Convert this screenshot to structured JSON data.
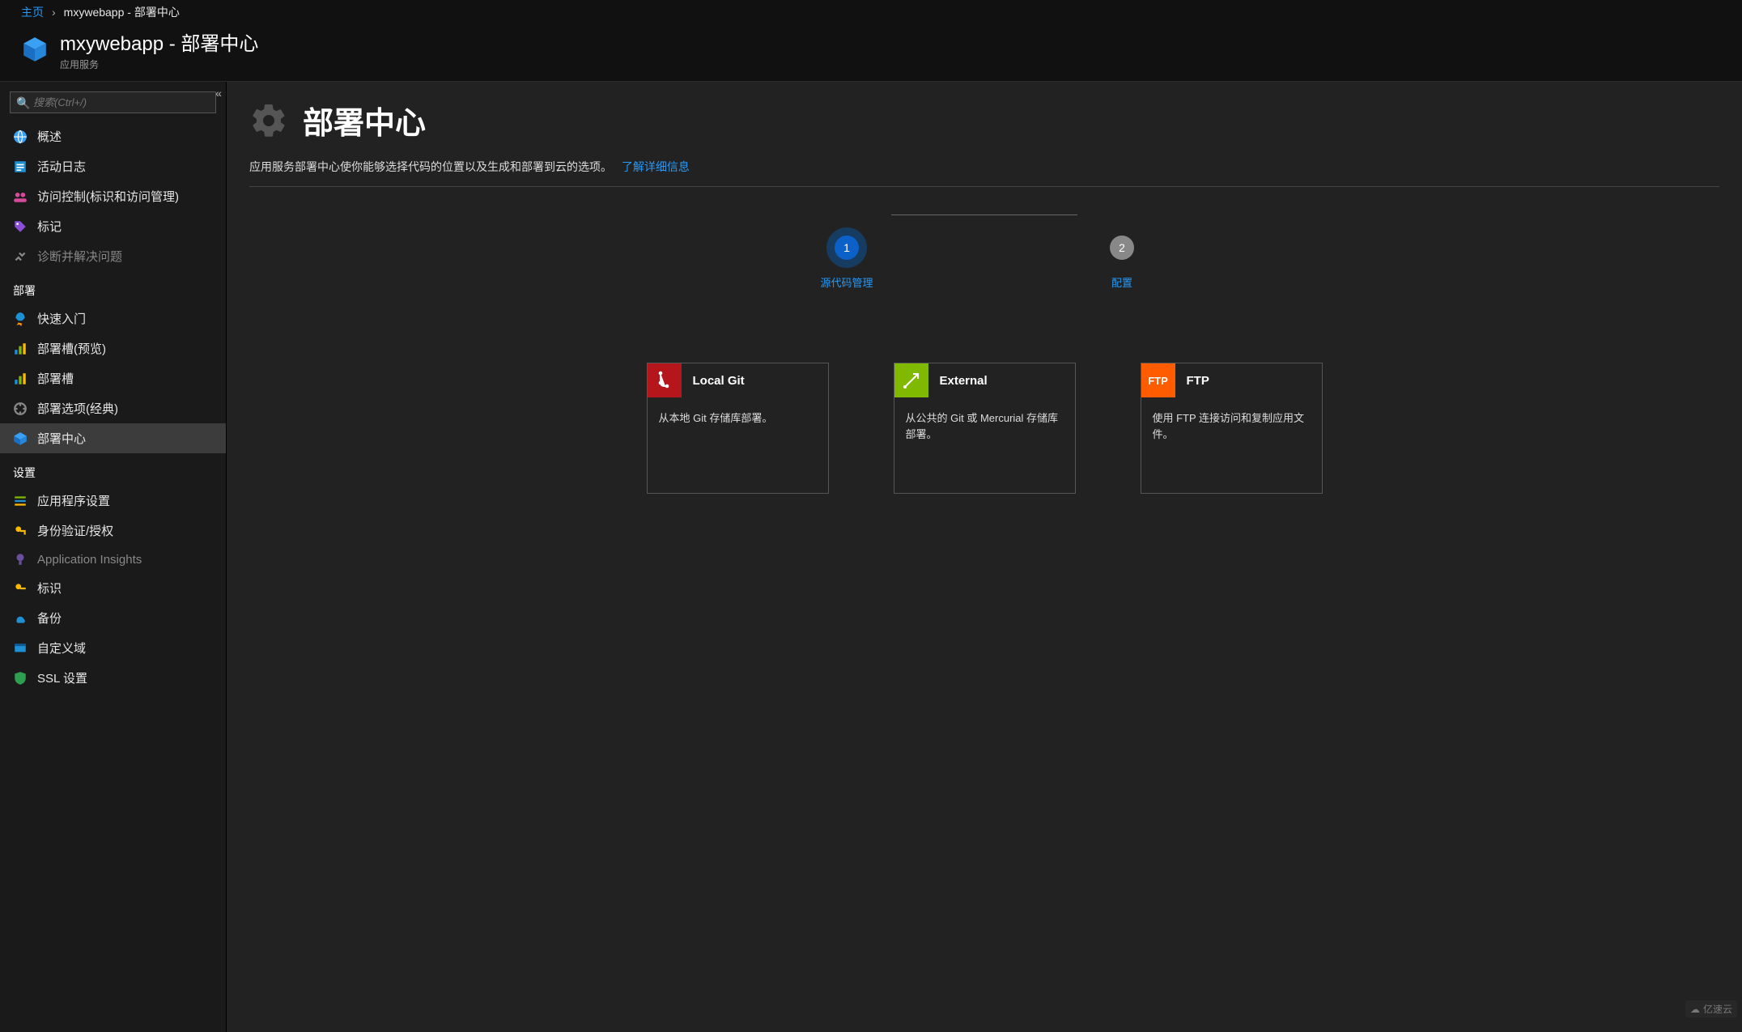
{
  "breadcrumb": {
    "home": "主页",
    "sep": "›",
    "current": "mxywebapp - 部署中心"
  },
  "header": {
    "title": "mxywebapp - 部署中心",
    "subtitle": "应用服务"
  },
  "sidebar": {
    "search_placeholder": "搜索(Ctrl+/)",
    "items_top": [
      {
        "icon": "globe",
        "label": "概述"
      },
      {
        "icon": "log",
        "label": "活动日志"
      },
      {
        "icon": "iam",
        "label": "访问控制(标识和访问管理)"
      },
      {
        "icon": "tag",
        "label": "标记"
      },
      {
        "icon": "diag",
        "label": "诊断并解决问题",
        "dim": true
      }
    ],
    "section_deploy": "部署",
    "items_deploy": [
      {
        "icon": "rocket",
        "label": "快速入门"
      },
      {
        "icon": "slot",
        "label": "部署槽(预览)"
      },
      {
        "icon": "slot2",
        "label": "部署槽"
      },
      {
        "icon": "options",
        "label": "部署选项(经典)"
      },
      {
        "icon": "center",
        "label": "部署中心",
        "selected": true
      }
    ],
    "section_settings": "设置",
    "items_settings": [
      {
        "icon": "appcfg",
        "label": "应用程序设置"
      },
      {
        "icon": "auth",
        "label": "身份验证/授权"
      },
      {
        "icon": "insights",
        "label": "Application Insights",
        "dim": true
      },
      {
        "icon": "id",
        "label": "标识"
      },
      {
        "icon": "backup",
        "label": "备份"
      },
      {
        "icon": "domain",
        "label": "自定义域"
      },
      {
        "icon": "ssl",
        "label": "SSL 设置"
      }
    ]
  },
  "content": {
    "title": "部署中心",
    "description": "应用服务部署中心使你能够选择代码的位置以及生成和部署到云的选项。",
    "learn_more": "了解详细信息",
    "steps": [
      {
        "num": "1",
        "label": "源代码管理",
        "active": true
      },
      {
        "num": "2",
        "label": "配置",
        "active": false
      }
    ],
    "cards": [
      {
        "variant": "git",
        "title": "Local Git",
        "icon_text": "",
        "body": "从本地 Git 存储库部署。"
      },
      {
        "variant": "ext",
        "title": "External",
        "icon_text": "",
        "body": "从公共的 Git 或 Mercurial 存储库部署。"
      },
      {
        "variant": "ftp",
        "title": "FTP",
        "icon_text": "FTP",
        "body": "使用 FTP 连接访问和复制应用文件。"
      }
    ]
  },
  "watermark": "亿速云"
}
